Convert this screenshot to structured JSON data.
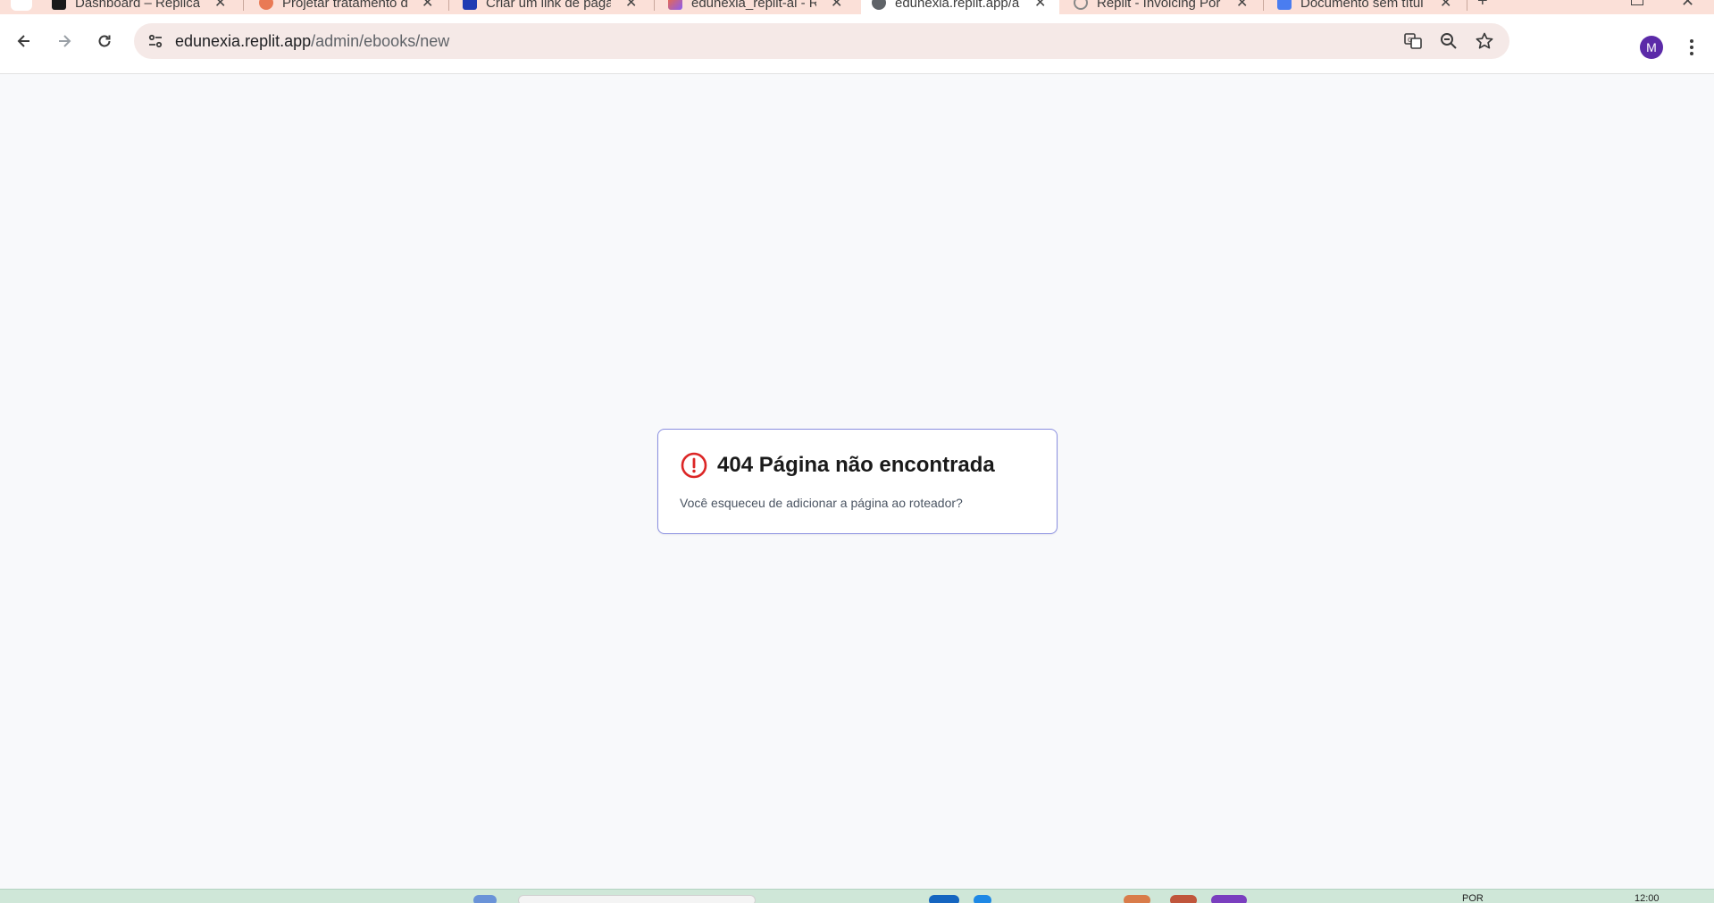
{
  "tabs": [
    {
      "title": "Dashboard – Replicar",
      "favicon": "bars-icon",
      "active": false
    },
    {
      "title": "Projetar tratamento d",
      "favicon": "asterisk-icon",
      "active": false
    },
    {
      "title": "Criar um link de paga",
      "favicon": "star-badge-icon",
      "active": false
    },
    {
      "title": "edunexia_replit-ai - R",
      "favicon": "grid-icon",
      "active": false
    },
    {
      "title": "edunexia.replit.app/a",
      "favicon": "globe-icon",
      "active": true
    },
    {
      "title": "Replit - Invoicing Por",
      "favicon": "loading-icon",
      "active": false
    },
    {
      "title": "Documento sem títul",
      "favicon": "doc-icon",
      "active": false
    }
  ],
  "address_bar": {
    "host": "edunexia.replit.app",
    "path": "/admin/ebooks/new"
  },
  "profile": {
    "initial": "M",
    "color": "#5b2aa8"
  },
  "error": {
    "title": "404 Página não encontrada",
    "description": "Você esqueceu de adicionar a página ao roteador?",
    "icon": "alert-circle-icon",
    "icon_color": "#dc2626",
    "border_color": "#8a8fe0"
  },
  "taskbar": {
    "language": "POR",
    "time": "12:00"
  }
}
